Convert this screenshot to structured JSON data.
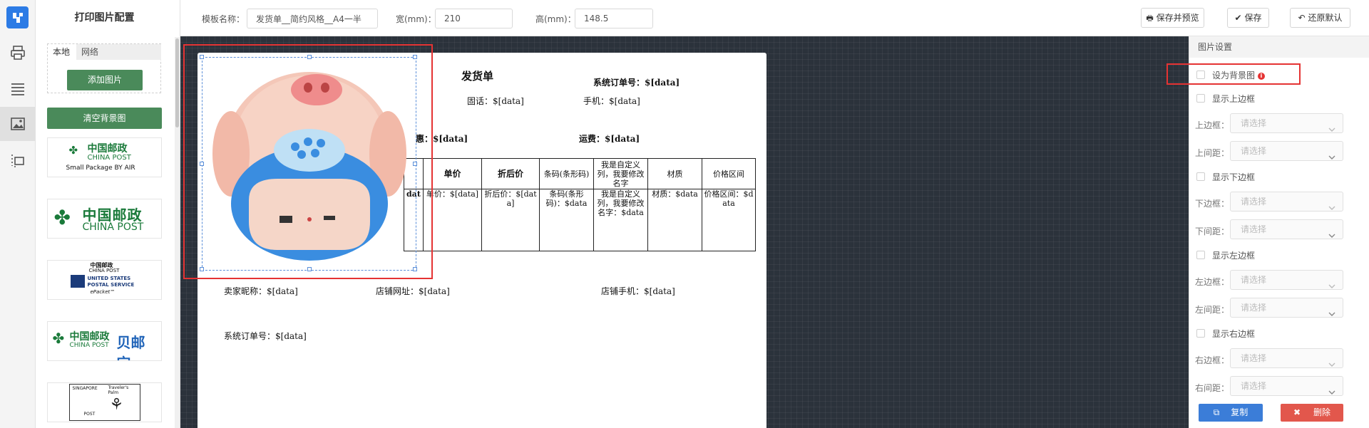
{
  "sidebar": {
    "title": "打印图片配置",
    "tabs": [
      {
        "label": "本地"
      },
      {
        "label": "网络"
      }
    ],
    "add_image_label": "添加图片",
    "clear_background_label": "清空背景图",
    "thumbnails": [
      {
        "line1": "中国邮政",
        "line2": "CHINA POST",
        "line3": "Small Package BY AIR"
      },
      {
        "line1": "中国邮政",
        "line2": "CHINA POST"
      },
      {
        "line1": "中国邮政",
        "line2": "CHINA POST",
        "line3": "UNITED STATES",
        "line4": "POSTAL SERVICE",
        "line5": "ePacket™"
      },
      {
        "line1": "中国邮政",
        "line2": "CHINA POST",
        "line3": "贝邮宝"
      },
      {
        "line1": "SINGAPORE",
        "line2": "Traveler's Palm",
        "line3": "POST"
      }
    ]
  },
  "toolbar": {
    "template_name_label": "模板名称：",
    "template_name_value": "发货单__简约风格__A4一半",
    "width_label": "宽(mm)：",
    "width_value": "210",
    "height_label": "高(mm)：",
    "height_value": "148.5",
    "save_preview_label": "保存并预览",
    "save_label": "保存",
    "restore_label": "还原默认"
  },
  "paper": {
    "title": "发货单",
    "order_no": "系统订单号：$[data]",
    "fixed_phone": "固话：$[data]",
    "mobile": "手机：$[data]",
    "discount": "惠：$[data]",
    "shipping": "运费：$[data]",
    "table": {
      "headers": [
        "",
        "单价",
        "折后价",
        "条码(条形码)",
        "我是自定义列，我要修改名字",
        "材质",
        "价格区间"
      ],
      "row": [
        "dat",
        "单价：$[data]",
        "折后价：$[data]",
        "条码(条形码)：$data",
        "我是自定义列，我要修改名字：$data",
        "材质：$data",
        "价格区间：$data"
      ]
    },
    "seller_nick": "卖家昵称：$[data]",
    "shop_url": "店铺网址：$[data]",
    "shop_phone": "店铺手机：$[data]",
    "system_order_no": "系统订单号：$[data]"
  },
  "settings": {
    "title": "图片设置",
    "set_bg_label": "设为背景图",
    "show_top_label": "显示上边框",
    "top_border_label": "上边框：",
    "top_margin_label": "上间距：",
    "show_bottom_label": "显示下边框",
    "bottom_border_label": "下边框：",
    "bottom_margin_label": "下间距：",
    "show_left_label": "显示左边框",
    "left_border_label": "左边框：",
    "left_margin_label": "左间距：",
    "show_right_label": "显示右边框",
    "right_border_label": "右边框：",
    "right_margin_label": "右间距：",
    "select_placeholder": "请选择",
    "copy_label": "复制",
    "delete_label": "删除"
  },
  "colors": {
    "accent": "#2c7be5",
    "green_button": "#4a8a5a",
    "danger": "#e2574c",
    "highlight": "#e53333",
    "canvas_bg": "#2b323b"
  },
  "icons": [
    "app-logo-icon",
    "printer-icon",
    "list-icon",
    "image-icon",
    "layout-icon",
    "chevron-down-icon",
    "info-icon",
    "copy-icon",
    "close-icon",
    "undo-icon",
    "check-icon"
  ]
}
